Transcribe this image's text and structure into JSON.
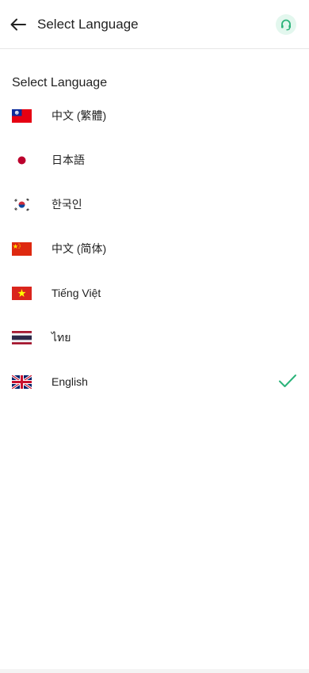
{
  "header": {
    "title": "Select Language",
    "back_icon": "arrow-left-icon",
    "support_icon": "headset-icon",
    "accent": "#2bb37a"
  },
  "section_title": "Select Language",
  "languages": [
    {
      "label": "中文 (繁體)",
      "flag": "taiwan-flag-icon",
      "selected": false
    },
    {
      "label": "日本語",
      "flag": "japan-flag-icon",
      "selected": false
    },
    {
      "label": "한국인",
      "flag": "korea-flag-icon",
      "selected": false
    },
    {
      "label": "中文 (简体)",
      "flag": "china-flag-icon",
      "selected": false
    },
    {
      "label": "Tiếng Việt",
      "flag": "vietnam-flag-icon",
      "selected": false
    },
    {
      "label": "ไทย",
      "flag": "thailand-flag-icon",
      "selected": false
    },
    {
      "label": "English",
      "flag": "uk-flag-icon",
      "selected": true
    }
  ]
}
